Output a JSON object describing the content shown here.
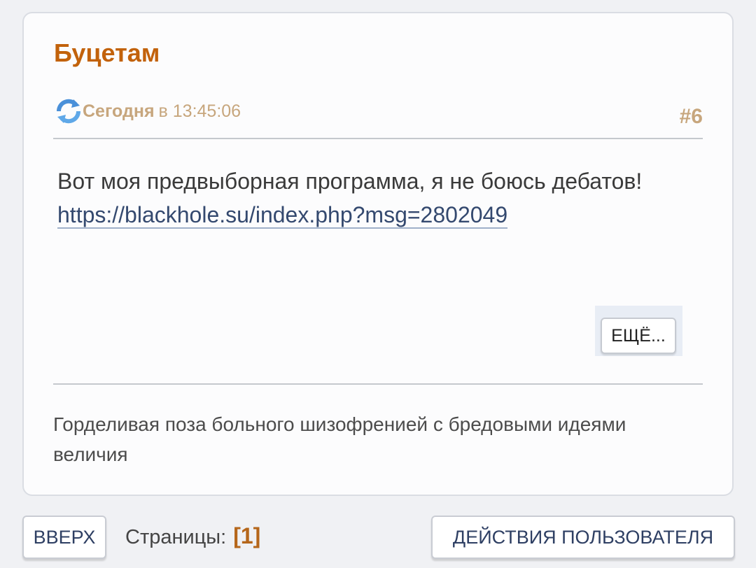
{
  "post": {
    "author": "Буцетам",
    "date_bold": "Сегодня",
    "date_rest": "в 13:45:06",
    "number": "#6",
    "body_text": "Вот моя предвыборная программа, я не боюсь дебатов!",
    "link": "https://blackhole.su/index.php?msg=2802049",
    "more_label": "ЕЩЁ...",
    "signature": "Горделивая поза больного шизофренией с бредовыми идеями величия"
  },
  "footer": {
    "top_label": "ВВЕРХ",
    "pages_label": "Страницы:",
    "current_page": "[1]",
    "actions_label": "ДЕЙСТВИЯ ПОЛЬЗОВАТЕЛЯ"
  },
  "icons": {
    "reload": "reload-icon"
  },
  "colors": {
    "author": "#c2620b",
    "meta": "#c7a67d",
    "link": "#34496f",
    "current_page": "#b5661a",
    "button_text": "#2e3f63"
  }
}
